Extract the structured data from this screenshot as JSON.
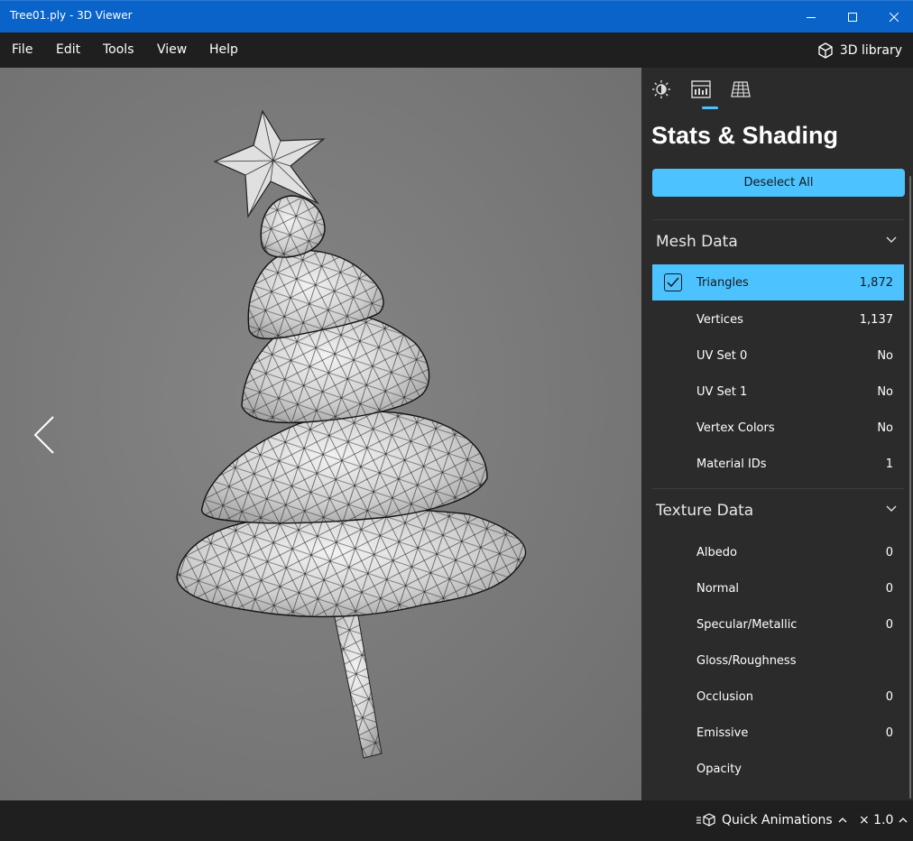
{
  "window": {
    "title": "Tree01.ply - 3D Viewer",
    "accent_color": "#0a63c9"
  },
  "menu": {
    "items": [
      "File",
      "Edit",
      "Tools",
      "View",
      "Help"
    ],
    "library_label": "3D library"
  },
  "panel": {
    "tab_icons": [
      "sun-icon",
      "stats-icon",
      "grid-icon"
    ],
    "active_tab": 1,
    "title": "Stats & Shading",
    "deselect_label": "Deselect All",
    "accent_color": "#4cc2ff",
    "mesh": {
      "header": "Mesh Data",
      "rows": [
        {
          "name": "Triangles",
          "value": "1,872",
          "selected": true
        },
        {
          "name": "Vertices",
          "value": "1,137"
        },
        {
          "name": "UV Set 0",
          "value": "No"
        },
        {
          "name": "UV Set 1",
          "value": "No"
        },
        {
          "name": "Vertex Colors",
          "value": "No"
        },
        {
          "name": "Material IDs",
          "value": "1"
        }
      ]
    },
    "texture": {
      "header": "Texture Data",
      "rows": [
        {
          "name": "Albedo",
          "value": "0"
        },
        {
          "name": "Normal",
          "value": "0"
        },
        {
          "name": "Specular/Metallic",
          "value": "0"
        },
        {
          "name": "Gloss/Roughness",
          "value": ""
        },
        {
          "name": "Occlusion",
          "value": "0"
        },
        {
          "name": "Emissive",
          "value": "0"
        },
        {
          "name": "Opacity",
          "value": ""
        }
      ]
    }
  },
  "status": {
    "animations_label": "Quick Animations",
    "speed_label": "× 1.0"
  }
}
